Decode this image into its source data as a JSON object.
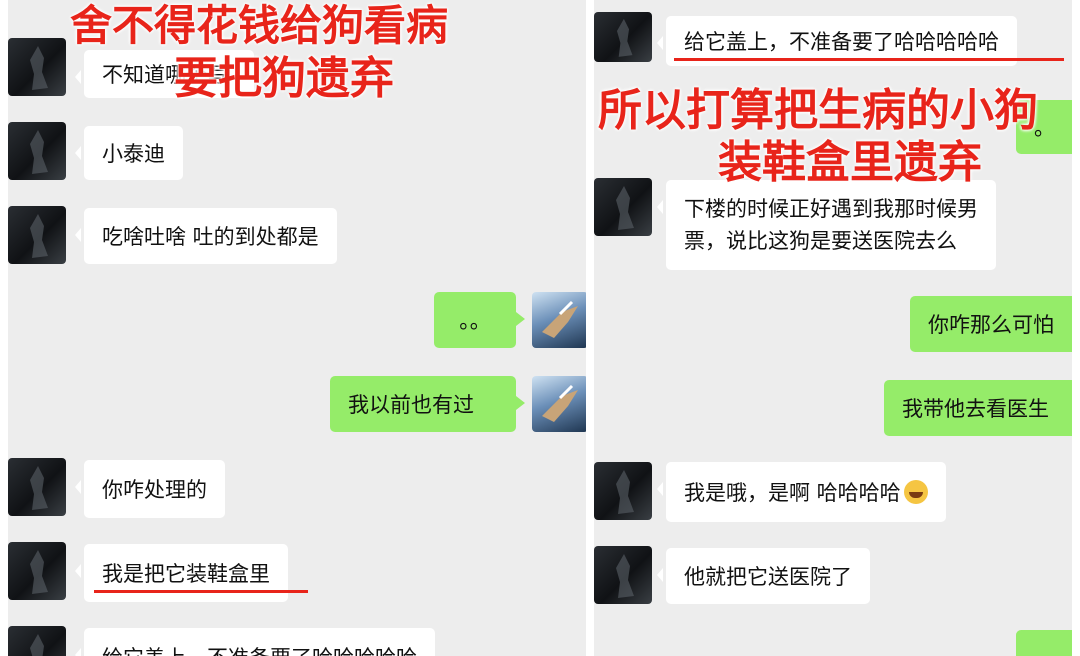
{
  "left": {
    "overlay_line1": "舍不得花钱给狗看病",
    "overlay_line2": "要把狗遗弃",
    "messages": [
      {
        "text": "不知道哪个写"
      },
      {
        "text": "小泰迪"
      },
      {
        "text": "吃啥吐啥 吐的到处都是"
      },
      {
        "text": "。。"
      },
      {
        "text": "我以前也有过"
      },
      {
        "text": "你咋处理的"
      },
      {
        "text": "我是把它装鞋盒里"
      },
      {
        "text": "给它盖上，不准备要了哈哈哈哈哈"
      }
    ]
  },
  "right": {
    "overlay_line1": "所以打算把生病的小狗",
    "overlay_line2": "装鞋盒里遗弃",
    "messages": [
      {
        "text": "给它盖上，不准备要了哈哈哈哈哈"
      },
      {
        "text": "。"
      },
      {
        "text": "下楼的时候正好遇到我那时候男"
      },
      {
        "text": "票，说比这狗是要送医院去么"
      },
      {
        "text": "你咋那么可怕"
      },
      {
        "text": "我带他去看医生"
      },
      {
        "text": "我是哦，是啊 哈哈哈哈"
      },
      {
        "text": "他就把它送医院了"
      }
    ]
  },
  "colors": {
    "sent": "#95ec69",
    "received": "#ffffff",
    "chat_bg": "#ededed",
    "annotation": "#e8241a"
  },
  "emoji_icon": "laughing-face-emoji"
}
